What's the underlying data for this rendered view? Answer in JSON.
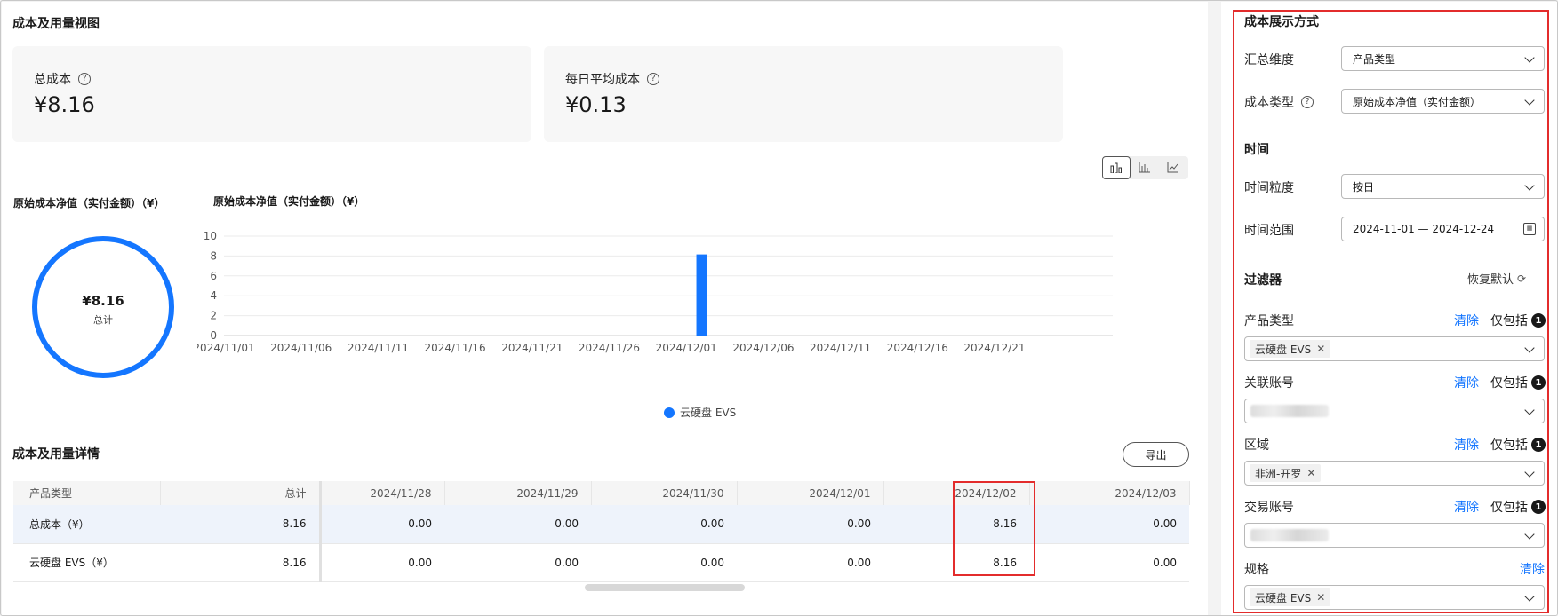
{
  "main": {
    "view_title": "成本及用量视图",
    "kpis": [
      {
        "label": "总成本",
        "value": "¥8.16"
      },
      {
        "label": "每日平均成本",
        "value": "¥0.13"
      }
    ],
    "chart_icons": [
      "bar-stack-icon",
      "bar-chart-icon",
      "line-chart-icon"
    ],
    "donut": {
      "title": "原始成本净值（实付金额）（¥）",
      "value": "¥8.16",
      "caption": "总计"
    },
    "bar_title": "原始成本净值（实付金额）（¥）",
    "legend": "云硬盘 EVS",
    "detail_title": "成本及用量详情",
    "export_label": "导出",
    "table": {
      "headers": [
        "产品类型",
        "总计",
        "2024/11/28",
        "2024/11/29",
        "2024/11/30",
        "2024/12/01",
        "2024/12/02",
        "2024/12/03"
      ],
      "rows": [
        [
          "总成本（¥）",
          "8.16",
          "0.00",
          "0.00",
          "0.00",
          "0.00",
          "8.16",
          "0.00"
        ],
        [
          "云硬盘 EVS（¥）",
          "8.16",
          "0.00",
          "0.00",
          "0.00",
          "0.00",
          "8.16",
          "0.00"
        ]
      ]
    }
  },
  "chart_data": {
    "type": "bar",
    "title": "原始成本净值（实付金额）（¥）",
    "xlabel": "",
    "ylabel": "",
    "ylim": [
      0,
      10
    ],
    "yticks": [
      0,
      2,
      4,
      6,
      8,
      10
    ],
    "xtick_labels": [
      "2024/11/01",
      "2024/11/06",
      "2024/11/11",
      "2024/11/16",
      "2024/11/21",
      "2024/11/26",
      "2024/12/01",
      "2024/12/06",
      "2024/12/11",
      "2024/12/16",
      "2024/12/21"
    ],
    "series": [
      {
        "name": "云硬盘 EVS",
        "color": "#1476ff",
        "points": [
          {
            "x": "2024/12/02",
            "y": 8.16
          }
        ]
      }
    ],
    "grid": true,
    "legend_position": "bottom"
  },
  "side": {
    "display_title": "成本展示方式",
    "agg_label": "汇总维度",
    "agg_value": "产品类型",
    "cost_type_label": "成本类型",
    "cost_type_value": "原始成本净值（实付金额）",
    "time_title": "时间",
    "granularity_label": "时间粒度",
    "granularity_value": "按日",
    "range_label": "时间范围",
    "range_value": "2024-11-01 — 2024-12-24",
    "filter_title": "过滤器",
    "reset_label": "恢复默认",
    "clear_label": "清除",
    "only_label": "仅包括",
    "only_count": "1",
    "filters": [
      {
        "label": "产品类型",
        "tag": "云硬盘 EVS"
      },
      {
        "label": "关联账号",
        "tag": ""
      },
      {
        "label": "区域",
        "tag": "非洲-开罗"
      },
      {
        "label": "交易账号",
        "tag": ""
      },
      {
        "label": "规格",
        "tag": "云硬盘 EVS"
      }
    ]
  }
}
